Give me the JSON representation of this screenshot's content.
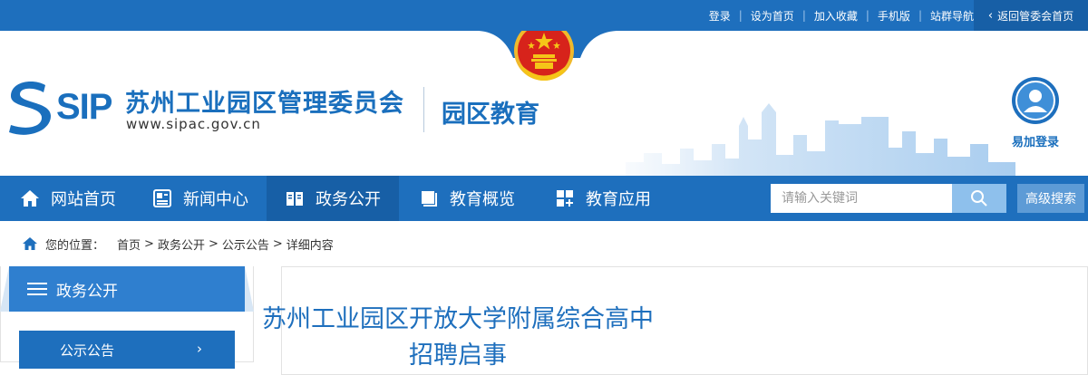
{
  "topbar": {
    "links": [
      "登录",
      "设为首页",
      "加入收藏",
      "手机版",
      "站群导航"
    ],
    "back_home": "返回管委会首页"
  },
  "header": {
    "logo_text": "SIP",
    "org_name": "苏州工业园区管理委员会",
    "org_url": "www.sipac.gov.cn",
    "section_name": "园区教育",
    "easy_login": "易加登录"
  },
  "nav": {
    "items": [
      {
        "label": "网站首页",
        "icon": "home-icon"
      },
      {
        "label": "新闻中心",
        "icon": "news-icon"
      },
      {
        "label": "政务公开",
        "icon": "book-icon",
        "active": true
      },
      {
        "label": "教育概览",
        "icon": "overview-icon"
      },
      {
        "label": "教育应用",
        "icon": "apps-icon"
      }
    ],
    "search_placeholder": "请输入关键词",
    "advanced_search": "高级搜索"
  },
  "breadcrumb": {
    "label": "您的位置：",
    "items": [
      "首页",
      "政务公开",
      "公示公告",
      "详细内容"
    ],
    "separator": ">"
  },
  "sidebar": {
    "heading": "政务公开",
    "items": [
      {
        "label": "公示公告"
      }
    ]
  },
  "article": {
    "title_line1": "苏州工业园区开放大学附属综合高中",
    "title_line2": "招聘启事"
  },
  "colors": {
    "primary": "#1e6fbd",
    "primary_dark": "#175fa6",
    "emblem_red": "#d7231b",
    "emblem_gold": "#f5c518"
  }
}
